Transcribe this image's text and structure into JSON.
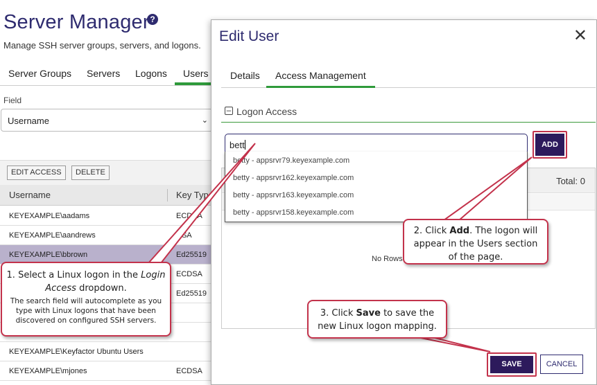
{
  "background": {
    "title": "Server Manager",
    "subtitle": "Manage SSH server groups, servers, and logons.",
    "tabs": [
      "Server Groups",
      "Servers",
      "Logons",
      "Users"
    ],
    "field_label": "Field",
    "field_value": "Username",
    "toolbar": {
      "edit_access": "EDIT ACCESS",
      "delete": "DELETE"
    },
    "columns": [
      "Username",
      "Key Typ"
    ],
    "rows": [
      {
        "username": "KEYEXAMPLE\\aadams",
        "key": "ECDSA",
        "selected": false
      },
      {
        "username": "KEYEXAMPLE\\aandrews",
        "key": "RSA",
        "selected": false
      },
      {
        "username": "KEYEXAMPLE\\bbrown",
        "key": "Ed25519",
        "selected": true
      },
      {
        "username": "",
        "key": "ECDSA",
        "selected": false
      },
      {
        "username": "",
        "key": "Ed25519",
        "selected": false
      },
      {
        "username": "",
        "key": "",
        "selected": false
      },
      {
        "username": "",
        "key": "",
        "selected": false
      },
      {
        "username": "KEYEXAMPLE\\Keyfactor Ubuntu Users",
        "key": "",
        "selected": false
      },
      {
        "username": "KEYEXAMPLE\\mjones",
        "key": "ECDSA",
        "selected": false
      }
    ]
  },
  "modal": {
    "title": "Edit User",
    "tabs": [
      "Details",
      "Access Management"
    ],
    "section": "Logon Access",
    "input_value": "bett",
    "add_label": "ADD",
    "suggestions": [
      "betty - appsrvr79.keyexample.com",
      "betty - appsrvr162.keyexample.com",
      "betty - appsrvr163.keyexample.com",
      "betty - appsrvr158.keyexample.com"
    ],
    "total": "Total: 0",
    "no_rows": "No Rows",
    "save_label": "SAVE",
    "cancel_label": "CANCEL"
  },
  "callouts": {
    "step1": {
      "pre": "1. Select a  Linux logon in the ",
      "em1": "Login Access",
      "post": " dropdown.",
      "note": "The search field will autocomplete as you type with Linux logons that have been discovered on configured SSH servers."
    },
    "step2": {
      "pre": "2. Click ",
      "bold": "Add",
      "post": ". The logon will appear in the Users section of the page."
    },
    "step3": {
      "pre": "3. Click ",
      "bold": "Save",
      "post": " to save the new Linux logon mapping."
    }
  },
  "colors": {
    "brand_purple": "#2d1a5c",
    "title_blue": "#2e2b6f",
    "accent_green": "#2e9a3a",
    "callout_red": "#c3324b",
    "selected_row": "#b9b1cc"
  }
}
